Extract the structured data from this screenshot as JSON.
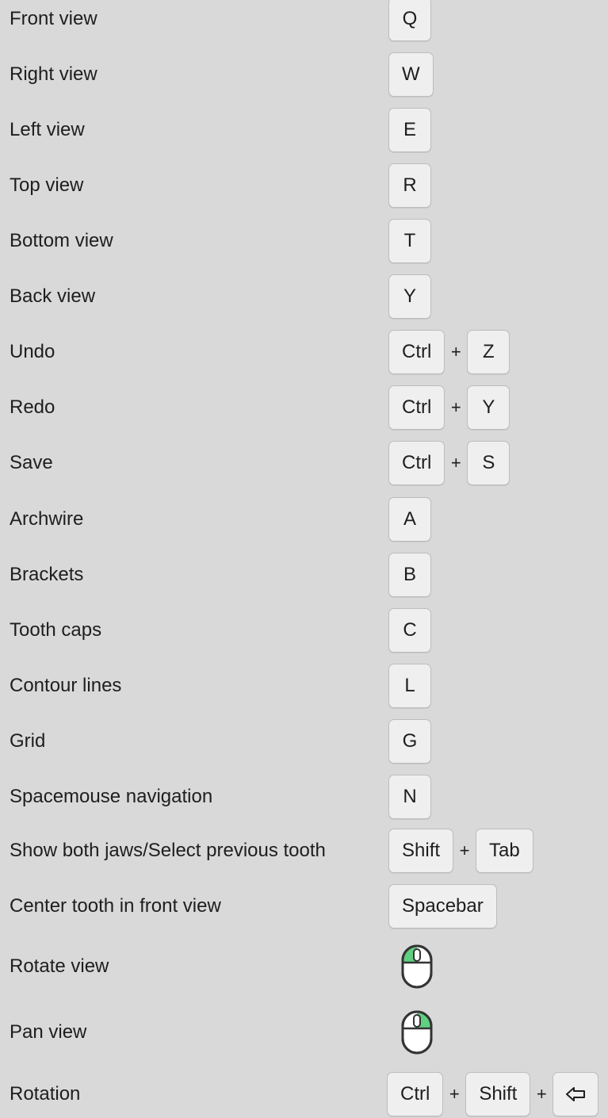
{
  "shortcuts": [
    {
      "label": "Front view",
      "keys": [
        "Q"
      ]
    },
    {
      "label": "Right view",
      "keys": [
        "W"
      ]
    },
    {
      "label": "Left view",
      "keys": [
        "E"
      ]
    },
    {
      "label": "Top view",
      "keys": [
        "R"
      ]
    },
    {
      "label": "Bottom view",
      "keys": [
        "T"
      ]
    },
    {
      "label": "Back view",
      "keys": [
        "Y"
      ]
    },
    {
      "label": "Undo",
      "keys": [
        "Ctrl",
        "Z"
      ]
    },
    {
      "label": "Redo",
      "keys": [
        "Ctrl",
        "Y"
      ]
    },
    {
      "label": "Save",
      "keys": [
        "Ctrl",
        "S"
      ]
    },
    {
      "label": "Archwire",
      "keys": [
        "A"
      ]
    },
    {
      "label": "Brackets",
      "keys": [
        "B"
      ]
    },
    {
      "label": "Tooth caps",
      "keys": [
        "C"
      ]
    },
    {
      "label": "Contour lines",
      "keys": [
        "L"
      ]
    },
    {
      "label": "Grid",
      "keys": [
        "G"
      ]
    },
    {
      "label": "Spacemouse navigation",
      "keys": [
        "N"
      ]
    },
    {
      "label": "Show both jaws/Select previous tooth",
      "keys": [
        "Shift",
        "Tab"
      ]
    },
    {
      "label": "Center tooth in front view",
      "keys": [
        "Spacebar"
      ]
    },
    {
      "label": "Rotate view",
      "mouse": "left-button"
    },
    {
      "label": "Pan view",
      "mouse": "right-button"
    },
    {
      "label": "Rotation",
      "keys": [
        "Ctrl",
        "Shift",
        "arrow-left-icon"
      ]
    }
  ],
  "plus_sign": "+",
  "colors": {
    "background": "#d9d9d9",
    "key_face": "#efefef",
    "key_border": "#bdbdbd",
    "mouse_highlight": "#5fcf80"
  }
}
